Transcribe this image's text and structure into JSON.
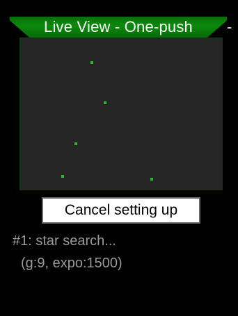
{
  "header": {
    "title": "Live View - One-push",
    "trailing": "-"
  },
  "live_view": {
    "stars_visible": 5
  },
  "actions": {
    "cancel_label": "Cancel setting up"
  },
  "status": {
    "line1": "#1: star search...",
    "line2": "(g:9, expo:1500)"
  },
  "colors": {
    "banner_green": "#0b8a0b",
    "star_green": "#2fb52f",
    "panel_bg": "#262626",
    "status_text": "#9a9a9a"
  }
}
